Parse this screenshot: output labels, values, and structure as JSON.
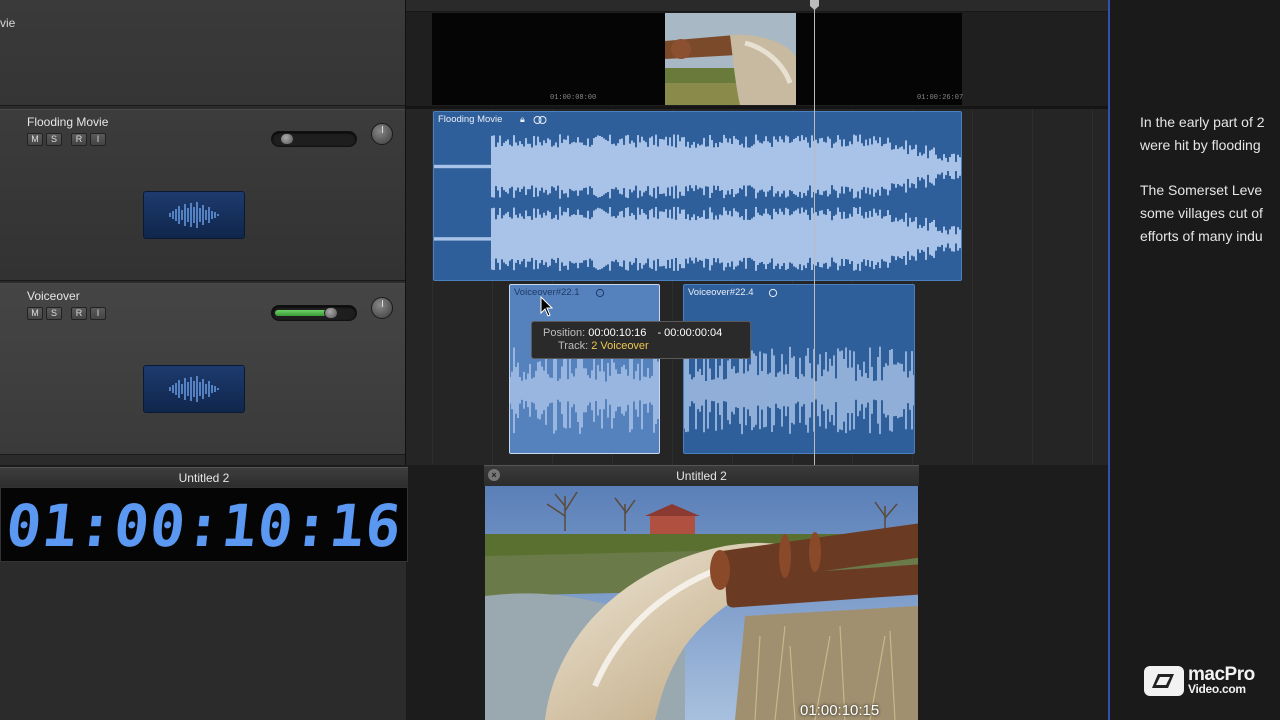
{
  "tracks": {
    "movie_label": "vie",
    "track1": {
      "name": "Flooding Movie",
      "volume_level": 0.15
    },
    "track2": {
      "name": "Voiceover",
      "volume_level": 0.72
    },
    "buttons": {
      "mute": "M",
      "solo": "S",
      "record": "R",
      "input": "I"
    }
  },
  "timeline": {
    "movie_timecodes": [
      "01:00:08:00",
      "01:00:26:07"
    ],
    "regions": {
      "flooding": "Flooding Movie",
      "voiceover_a": "Voiceover#22.1",
      "voiceover_b": "Voiceover#22.4"
    }
  },
  "tooltip": {
    "position_label": "Position:",
    "position_value": "00:00:10:16",
    "delta": "- 00:00:00:04",
    "track_label": "Track:",
    "track_number": "2",
    "track_name": "Voiceover"
  },
  "lcd": {
    "title": "Untitled 2",
    "timecode": "01:00:10:16"
  },
  "viewer": {
    "title": "Untitled 2",
    "timecode": "01:00:10:15",
    "close_icon": "×"
  },
  "notes": {
    "line1": "In the early part of 2",
    "line2": "were hit by flooding",
    "line3": "The Somerset Leve",
    "line4": "some villages cut of",
    "line5": "efforts of many indu"
  },
  "brand": {
    "line1": "macPro",
    "line2": "Video.com"
  },
  "colors": {
    "region_blue": "#2f5f9a",
    "waveform": "#a9c3e8",
    "lcd_digits": "#5a98f2",
    "tooltip_track": "#f0c850",
    "volume_green": "#4cb648"
  }
}
